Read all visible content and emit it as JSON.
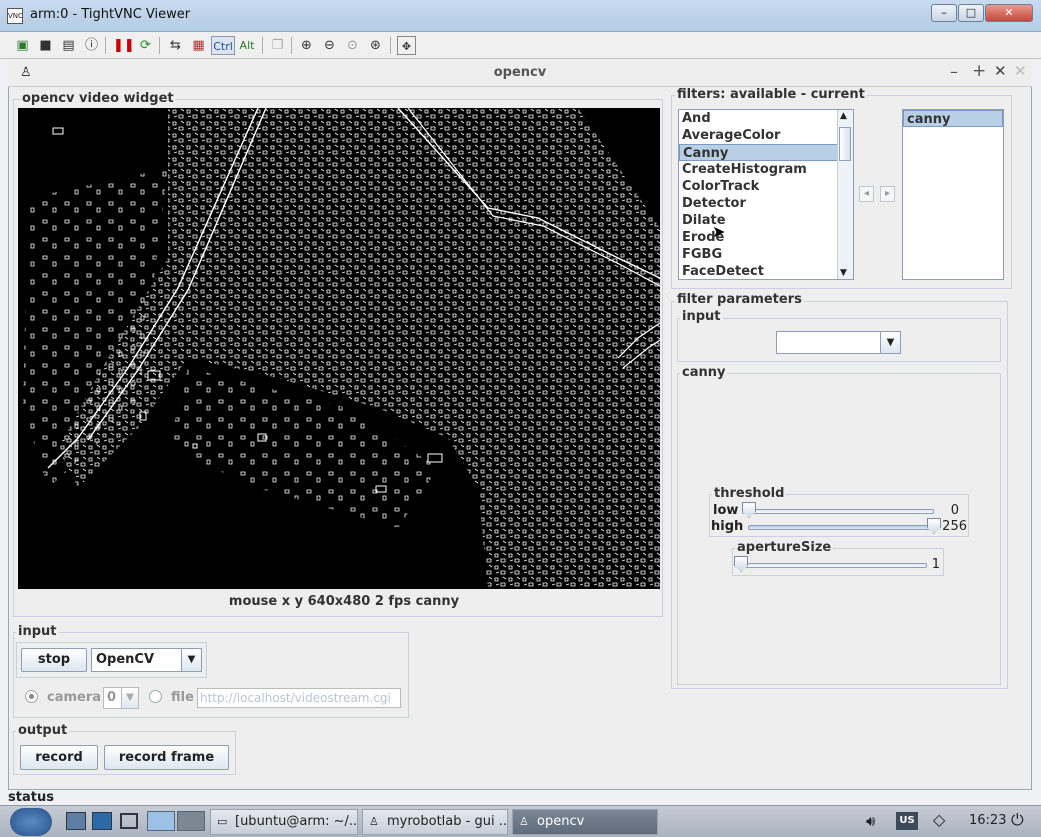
{
  "window": {
    "title": "arm:0 - TightVNC Viewer",
    "icon": "vnc-icon",
    "min": "–",
    "max": "□",
    "close": "✕"
  },
  "toolbar": {
    "ctrl": "Ctrl",
    "alt": "Alt",
    "icons": [
      "new-connection-icon",
      "save-icon",
      "options-icon",
      "info-icon",
      "pause-icon",
      "refresh-icon",
      "transfer-icon",
      "ctrl-alt-del-icon",
      "copy-icon",
      "zoom-in-icon",
      "zoom-out-icon",
      "zoom-fit-icon",
      "zoom-actual-icon",
      "fullscreen-icon"
    ]
  },
  "app": {
    "title": "opencv",
    "win_min": "–",
    "win_max": "+",
    "win_close": "✕"
  },
  "video": {
    "group_title": "opencv  video widget",
    "status": "mouse x y  640x480  2 fps  canny"
  },
  "input": {
    "group_title": "input",
    "stop": "stop",
    "source": "OpenCV",
    "camera_label": "camera",
    "camera_index": "0",
    "file_label": "file",
    "url": "http://localhost/videostream.cgi"
  },
  "output": {
    "group_title": "output",
    "record": "record",
    "record_frame": "record frame"
  },
  "filters": {
    "group_title": "filters: available - current",
    "available": [
      "And",
      "AverageColor",
      "Canny",
      "CreateHistogram",
      "ColorTrack",
      "Detector",
      "Dilate",
      "Erode",
      "FGBG",
      "FaceDetect"
    ],
    "selected_available": "Canny",
    "current": [
      "canny"
    ],
    "left_arrow": "◂",
    "right_arrow": "▸"
  },
  "params": {
    "group_title": "filter parameters",
    "input_title": "input",
    "input_value": "",
    "canny_title": "canny",
    "threshold_title": "threshold",
    "low_label": "low",
    "low_value": "0",
    "high_label": "high",
    "high_value": "256",
    "aperture_title": "apertureSize",
    "aperture_value": "1"
  },
  "status": {
    "label": "status"
  },
  "taskbar": {
    "tasks": [
      "[ubuntu@arm: ~/...",
      "myrobotlab - gui ...",
      "opencv"
    ],
    "layout": "US",
    "clock": "16:23"
  }
}
